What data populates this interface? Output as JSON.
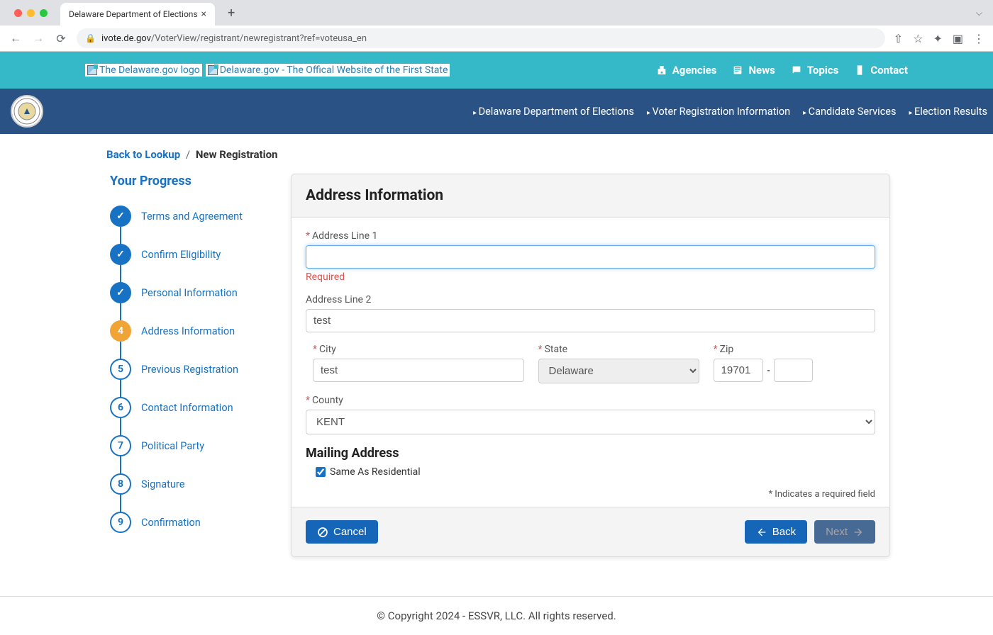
{
  "browser": {
    "tab_title": "Delaware Department of Elections",
    "url_host": "ivote.de.gov",
    "url_path": "/VoterView/registrant/newregistrant?ref=voteusa_en"
  },
  "gov_bar": {
    "logo_alt": "The Delaware.gov logo",
    "tagline": "Delaware.gov - The Offical Website of the First State",
    "links": {
      "agencies": "Agencies",
      "news": "News",
      "topics": "Topics",
      "contact": "Contact"
    }
  },
  "dept_nav": {
    "links": [
      "Delaware Department of Elections",
      "Voter Registration Information",
      "Candidate Services",
      "Election Results"
    ]
  },
  "breadcrumb": {
    "back": "Back to Lookup",
    "current": "New Registration"
  },
  "progress": {
    "title": "Your Progress",
    "steps": [
      {
        "num": "1",
        "label": "Terms and Agreement",
        "state": "done"
      },
      {
        "num": "2",
        "label": "Confirm Eligibility",
        "state": "done"
      },
      {
        "num": "3",
        "label": "Personal Information",
        "state": "done"
      },
      {
        "num": "4",
        "label": "Address Information",
        "state": "active"
      },
      {
        "num": "5",
        "label": "Previous Registration",
        "state": "pending"
      },
      {
        "num": "6",
        "label": "Contact Information",
        "state": "pending"
      },
      {
        "num": "7",
        "label": "Political Party",
        "state": "pending"
      },
      {
        "num": "8",
        "label": "Signature",
        "state": "pending"
      },
      {
        "num": "9",
        "label": "Confirmation",
        "state": "pending"
      }
    ]
  },
  "form": {
    "title": "Address Information",
    "labels": {
      "addr1": "Address Line 1",
      "addr2": "Address Line 2",
      "city": "City",
      "state": "State",
      "zip": "Zip",
      "county": "County",
      "mailing_heading": "Mailing Address",
      "same_as": "Same As Residential",
      "required_note": "* Indicates a required field",
      "error_required": "Required"
    },
    "values": {
      "addr1": "",
      "addr2": "test",
      "city": "test",
      "state": "Delaware",
      "zip": "19701",
      "zip_ext": "",
      "county": "KENT",
      "same_as_checked": true
    },
    "zip_sep": "-",
    "actions": {
      "cancel": "Cancel",
      "back": "Back",
      "next": "Next"
    }
  },
  "footer": {
    "copyright": "© Copyright 2024 - ESSVR, LLC. All rights reserved."
  }
}
